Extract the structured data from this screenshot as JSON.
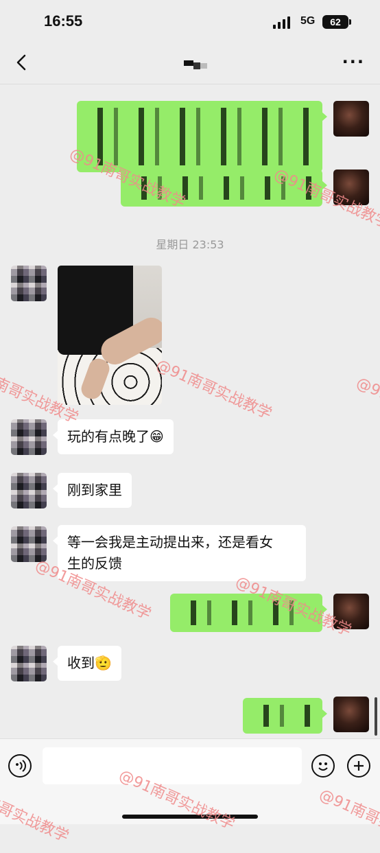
{
  "status_bar": {
    "time": "16:55",
    "network": "5G",
    "battery": "62"
  },
  "nav": {
    "title": ""
  },
  "timestamp": "星期日 23:53",
  "messages": {
    "m1": "玩的有点晚了",
    "m2": "刚到家里",
    "m3_line1": "等一会我是主动提出来，还是看女",
    "m3_line2": "生的反馈",
    "m4": "收到"
  },
  "emojis": {
    "grin": "😁",
    "salute": "🫡"
  },
  "watermark": "@91南哥实战教学",
  "colors": {
    "me_bubble": "#95ec69",
    "them_bubble": "#ffffff",
    "background": "#ededed",
    "watermark": "#f08a8a"
  }
}
